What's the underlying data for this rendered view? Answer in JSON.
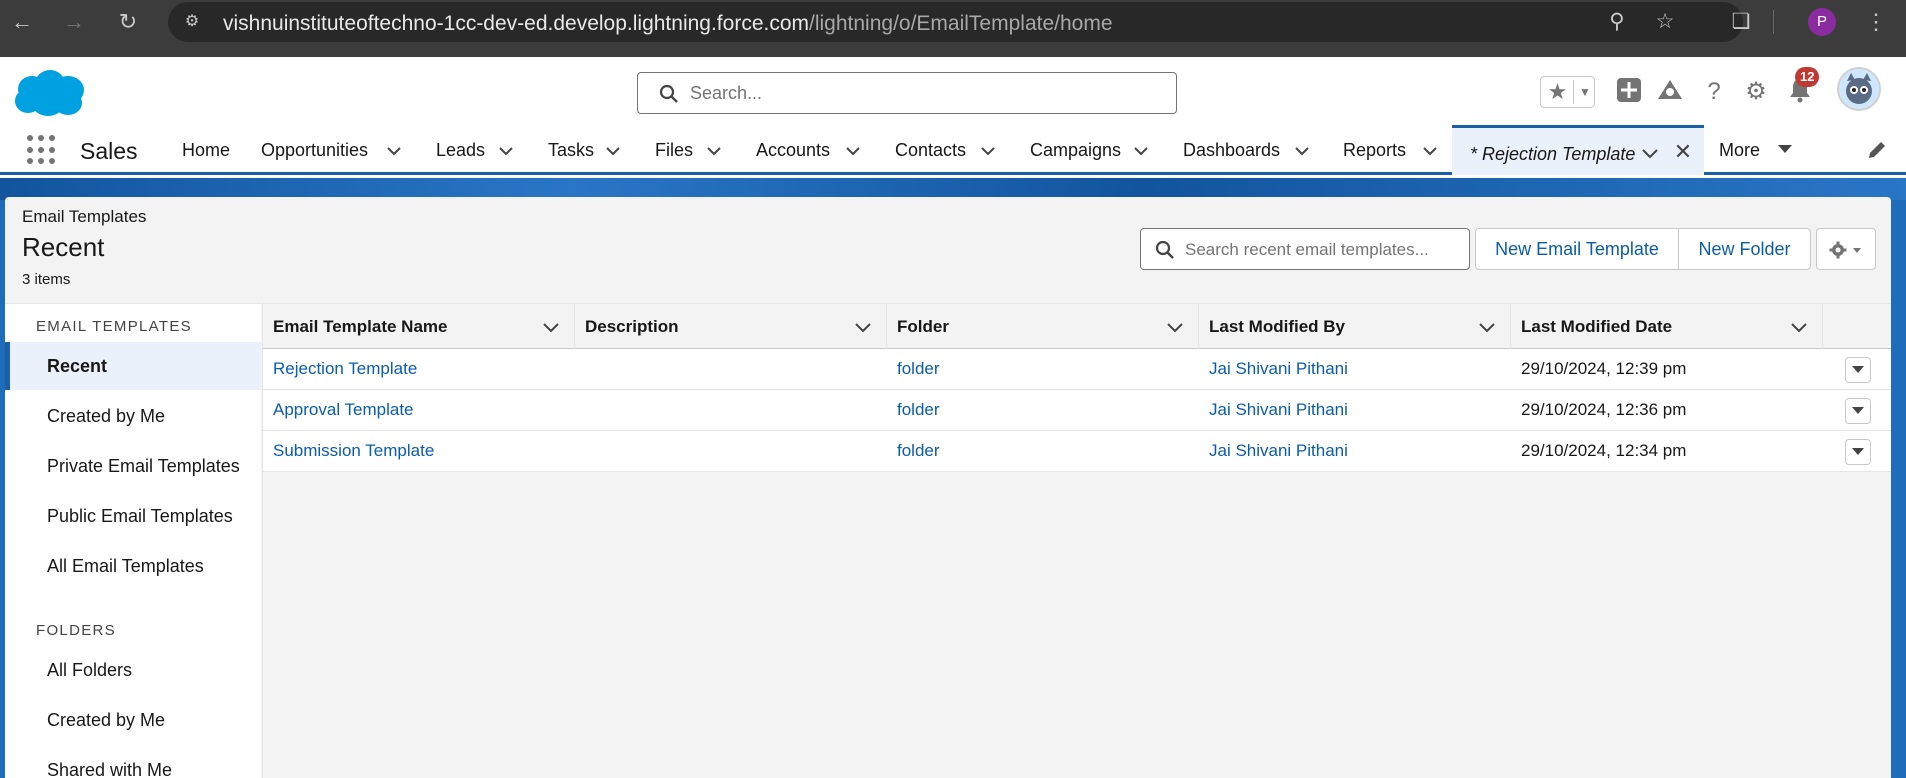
{
  "browser": {
    "url_main": "vishnuinstituteoftechno-1cc-dev-ed.develop.lightning.force.com",
    "url_path": "/lightning/o/EmailTemplate/home",
    "profile_initial": "P",
    "icons": [
      "back-icon",
      "forward-icon",
      "reload-icon",
      "site-info-icon",
      "zoom-icon",
      "bookmark-star-icon",
      "extensions-icon",
      "menu-icon"
    ]
  },
  "header": {
    "search_placeholder": "Search...",
    "notification_count": "12",
    "colors": {
      "brand": "#00a1e0",
      "badge": "#c23934",
      "link": "#0b5cab",
      "nav_accent": "#1b5fa6"
    }
  },
  "nav": {
    "app_name": "Sales",
    "items": [
      "Home",
      "Opportunities",
      "Leads",
      "Tasks",
      "Files",
      "Accounts",
      "Contacts",
      "Campaigns",
      "Dashboards",
      "Reports"
    ],
    "active_tab": "* Rejection Template",
    "more": "More"
  },
  "page": {
    "object_label": "Email Templates",
    "list_title": "Recent",
    "item_count": "3 items",
    "search_placeholder": "Search recent email templates...",
    "new_template_button": "New Email Template",
    "new_folder_button": "New Folder"
  },
  "sidebar": {
    "section1": "EMAIL TEMPLATES",
    "items1": [
      "Recent",
      "Created by Me",
      "Private Email Templates",
      "Public Email Templates",
      "All Email Templates"
    ],
    "section2": "FOLDERS",
    "items2": [
      "All Folders",
      "Created by Me",
      "Shared with Me"
    ],
    "active": "Recent"
  },
  "table": {
    "columns": [
      "Email Template Name",
      "Description",
      "Folder",
      "Last Modified By",
      "Last Modified Date"
    ],
    "rows": [
      {
        "name": "Rejection Template",
        "description": "",
        "folder": "folder",
        "modified_by": "Jai Shivani Pithani",
        "modified_date": "29/10/2024, 12:39 pm"
      },
      {
        "name": "Approval Template",
        "description": "",
        "folder": "folder",
        "modified_by": "Jai Shivani Pithani",
        "modified_date": "29/10/2024, 12:36 pm"
      },
      {
        "name": "Submission Template",
        "description": "",
        "folder": "folder",
        "modified_by": "Jai Shivani Pithani",
        "modified_date": "29/10/2024, 12:34 pm"
      }
    ]
  }
}
